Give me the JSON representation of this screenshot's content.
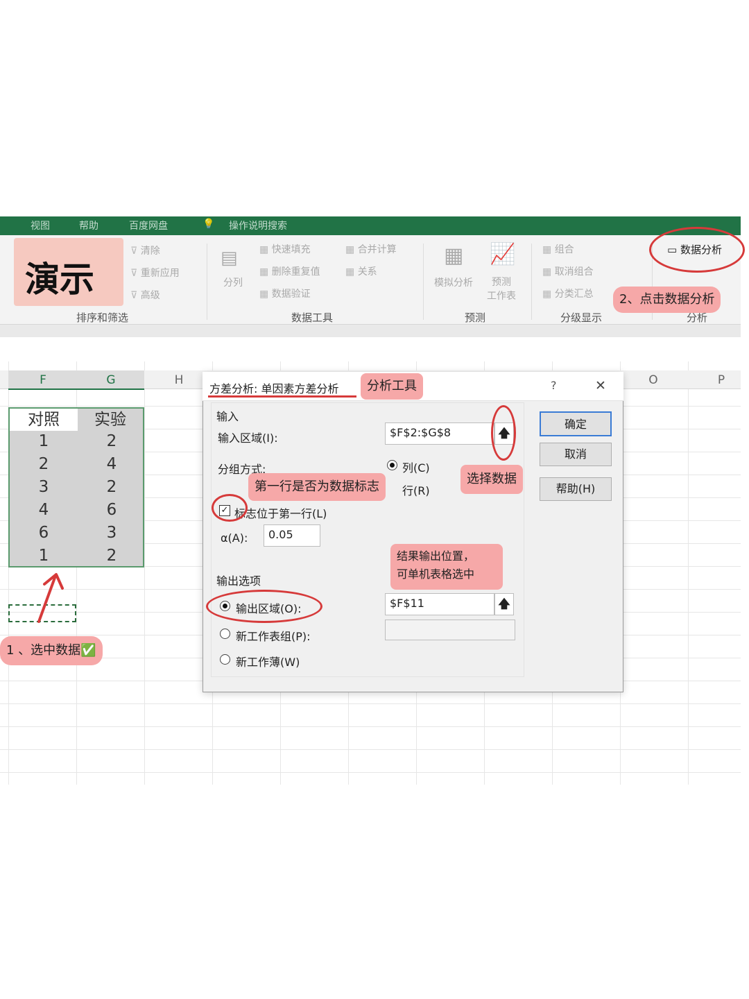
{
  "ribbon": {
    "menu": [
      "视图",
      "帮助",
      "百度网盘",
      "操作说明搜索"
    ],
    "demo_label": "演示",
    "sort_filter": {
      "items": [
        "清除",
        "重新应用",
        "高级"
      ],
      "group": "排序和筛选"
    },
    "data_tools": {
      "split": "分列",
      "items": [
        "快速填充",
        "删除重复值",
        "数据验证",
        "合并计算",
        "关系"
      ],
      "group": "数据工具"
    },
    "forecast": {
      "items": [
        "模拟分析",
        "预测\n工作表"
      ],
      "group": "预测"
    },
    "outline": {
      "items": [
        "组合",
        "取消组合",
        "分类汇总"
      ],
      "group": "分级显示"
    },
    "analysis": {
      "button": "数据分析",
      "group": "分析"
    }
  },
  "columns": [
    "F",
    "G",
    "H",
    "O",
    "P"
  ],
  "table": {
    "headers": [
      "对照",
      "实验"
    ],
    "rows": [
      [
        "1",
        "2"
      ],
      [
        "2",
        "4"
      ],
      [
        "3",
        "2"
      ],
      [
        "4",
        "6"
      ],
      [
        "6",
        "3"
      ],
      [
        "1",
        "2"
      ]
    ]
  },
  "dialog": {
    "title": "方差分析: 单因素方差分析",
    "help_glyph": "?",
    "close_glyph": "✕",
    "input_section": "输入",
    "input_range_label": "输入区域(I):",
    "input_range_value": "$F$2:$G$8",
    "grouping_label": "分组方式:",
    "by_column": "列(C)",
    "by_row": "行(R)",
    "labels_first_row": "标志位于第一行(L)",
    "alpha_label": "α(A):",
    "alpha_value": "0.05",
    "output_section": "输出选项",
    "output_range": "输出区域(O):",
    "output_range_value": "$F$11",
    "new_sheet": "新工作表组(P):",
    "new_workbook": "新工作薄(W)",
    "ok": "确定",
    "cancel": "取消",
    "help": "帮助(H)",
    "up_arrow": "🡅"
  },
  "annotations": {
    "step2": "2、点击数据分析",
    "tool": "分析工具",
    "select_data": "选择数据",
    "first_row": "第一行是否为数据标志",
    "output_pos": "结果输出位置，\n可单机表格选中",
    "step1": "1 、选中数据✅"
  },
  "colors": {
    "excel_green": "#217346",
    "annotation_pink": "#f6a8a8",
    "circle_red": "#d63a3a"
  }
}
